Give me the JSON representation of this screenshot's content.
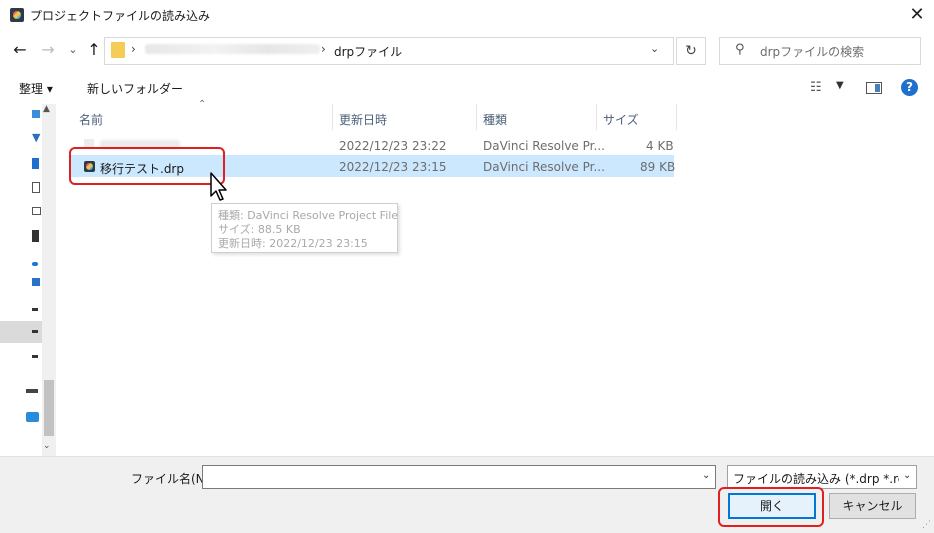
{
  "window": {
    "title": "プロジェクトファイルの読み込み",
    "close": "✕"
  },
  "nav": {
    "back": "←",
    "forward": "→",
    "recent": "⌄",
    "up": "↑",
    "breadcrumb_sep": "›",
    "path_current": "drpファイル",
    "refresh": "↻",
    "search_placeholder": "drpファイルの検索"
  },
  "toolbar": {
    "organize_label": "整理 ▾",
    "new_folder_label": "新しいフォルダー",
    "help": "?"
  },
  "columns": {
    "name": "名前",
    "modified": "更新日時",
    "type": "種類",
    "size": "サイズ"
  },
  "files": [
    {
      "name": "",
      "modified": "2022/12/23 23:22",
      "type": "DaVinci Resolve Pr...",
      "size": "4 KB"
    },
    {
      "name": "移行テスト.drp",
      "modified": "2022/12/23 23:15",
      "type": "DaVinci Resolve Pr...",
      "size": "89 KB"
    }
  ],
  "tooltip": {
    "type_line": "種類: DaVinci Resolve Project File",
    "size_line": "サイズ: 88.5 KB",
    "date_line": "更新日時: 2022/12/23 23:15"
  },
  "footer": {
    "filename_label": "ファイル名(N):",
    "filename_value": "",
    "filter_text": "ファイルの読み込み (*.drp *.resolv",
    "open_label": "開く",
    "cancel_label": "キャンセル"
  },
  "colors": {
    "selection": "#cce8ff",
    "highlight": "#e02020",
    "accent": "#0078d7"
  }
}
